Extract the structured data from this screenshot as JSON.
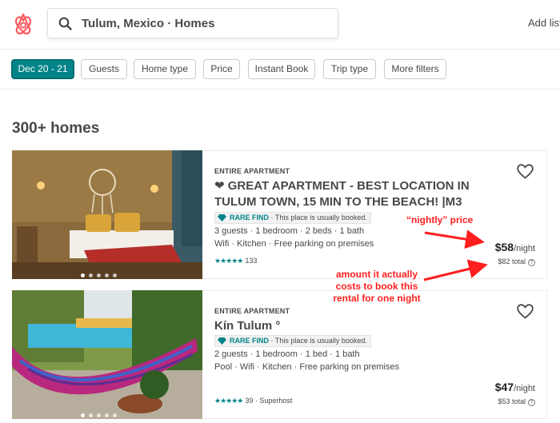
{
  "header": {
    "search_text": "Tulum, Mexico · Homes",
    "add_listing_label": "Add list",
    "brand_color": "#ff5a5f"
  },
  "filters": {
    "chips": [
      "Dec 20 - 21",
      "Guests",
      "Home type",
      "Price",
      "Instant Book",
      "Trip type",
      "More filters"
    ],
    "active_color": "#008489"
  },
  "results": {
    "title": "300+ homes"
  },
  "listings": [
    {
      "type": "ENTIRE APARTMENT",
      "title": "❤ GREAT APARTMENT - BEST LOCATION IN TULUM TOWN, 15 MIN TO THE BEACH! |M3",
      "rare_label": "RARE FIND",
      "rare_text": " · This place is usually booked.",
      "amenities_1": "3 guests · 1 bedroom · 2 beds · 1 bath",
      "amenities_2": "Wifi · Kitchen · Free parking on premises",
      "stars": "★★★★★",
      "reviews": "133",
      "price": "$58",
      "per_night": "/night",
      "total": "$82 total",
      "total_help": "?"
    },
    {
      "type": "ENTIRE APARTMENT",
      "title": "Kín Tulum °",
      "rare_label": "RARE FIND",
      "rare_text": " · This place is usually booked.",
      "amenities_1": "2 guests · 1 bedroom · 1 bed · 1 bath",
      "amenities_2": "Pool · Wifi · Kitchen · Free parking on premises",
      "stars": "★★★★★",
      "reviews": "39 · Superhost",
      "price": "$47",
      "per_night": "/night",
      "total": "$53 total",
      "total_help": "?"
    }
  ],
  "annotations": {
    "nightly": "“nightly” price",
    "amount_line1": "amount it actually",
    "amount_line2": "costs to book this",
    "amount_line3": "rental for one night",
    "color": "#ff1f1f"
  }
}
